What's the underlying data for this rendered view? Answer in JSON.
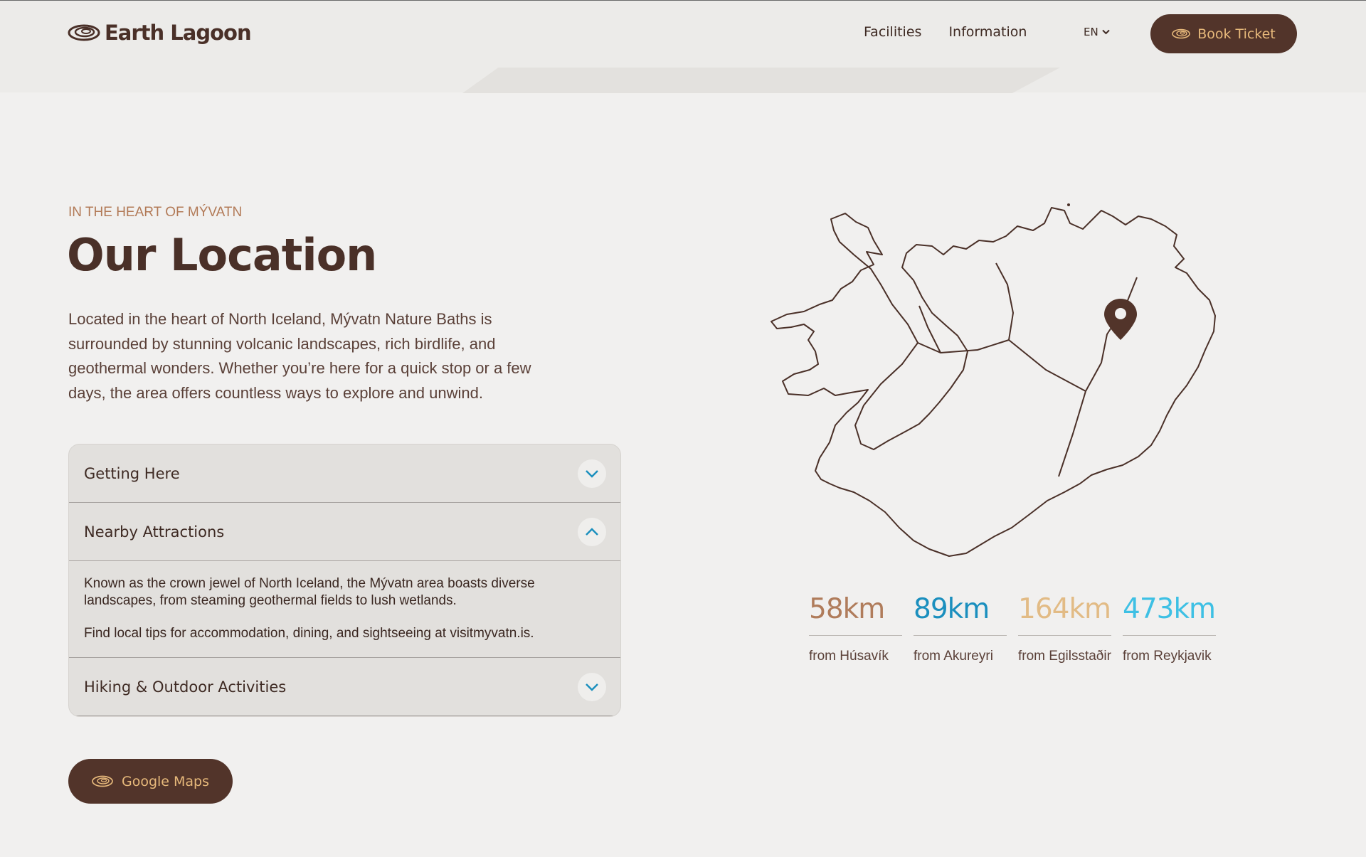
{
  "header": {
    "brand": "Earth Lagoon",
    "nav": [
      {
        "label": "Facilities"
      },
      {
        "label": "Information"
      }
    ],
    "language": "EN",
    "book_label": "Book Ticket"
  },
  "location": {
    "eyebrow": "IN THE HEART OF MÝVATN",
    "title": "Our Location",
    "intro": "Located in the heart of North Iceland, Mývatn Nature Baths is surrounded by stunning volcanic landscapes, rich birdlife, and geothermal wonders. Whether you’re here for a quick stop or a few days, the area offers countless ways to explore and unwind."
  },
  "accordion": {
    "items": [
      {
        "title": "Getting Here",
        "expanded": false
      },
      {
        "title": "Nearby Attractions",
        "expanded": true,
        "body": [
          "Known as the crown jewel of North Iceland, the Mývatn area boasts diverse landscapes, from steaming geothermal fields to lush wetlands.",
          "Find local tips for accommodation, dining, and sightseeing at visitmyvatn.is."
        ]
      },
      {
        "title": "Hiking & Outdoor Activities",
        "expanded": false
      }
    ]
  },
  "maps_button": "Google Maps",
  "distances": [
    {
      "value": "58km",
      "label": "from Húsavík",
      "color": "#b07c5b"
    },
    {
      "value": "89km",
      "label": "from Akureyri",
      "color": "#1b8fbe"
    },
    {
      "value": "164km",
      "label": "from Egilsstaðir",
      "color": "#e2bb85"
    },
    {
      "value": "473km",
      "label": "from Reykjavik",
      "color": "#3ec0e4"
    }
  ],
  "colors": {
    "brand_dark": "#52342a",
    "accent_gold": "#e7b97b",
    "accent_blue": "#1b8fbe",
    "eyebrow": "#b27a57"
  },
  "icons": {
    "logo": "lagoon-swirl-icon",
    "pin": "location-pin-icon",
    "chevron": "chevron-icon"
  }
}
